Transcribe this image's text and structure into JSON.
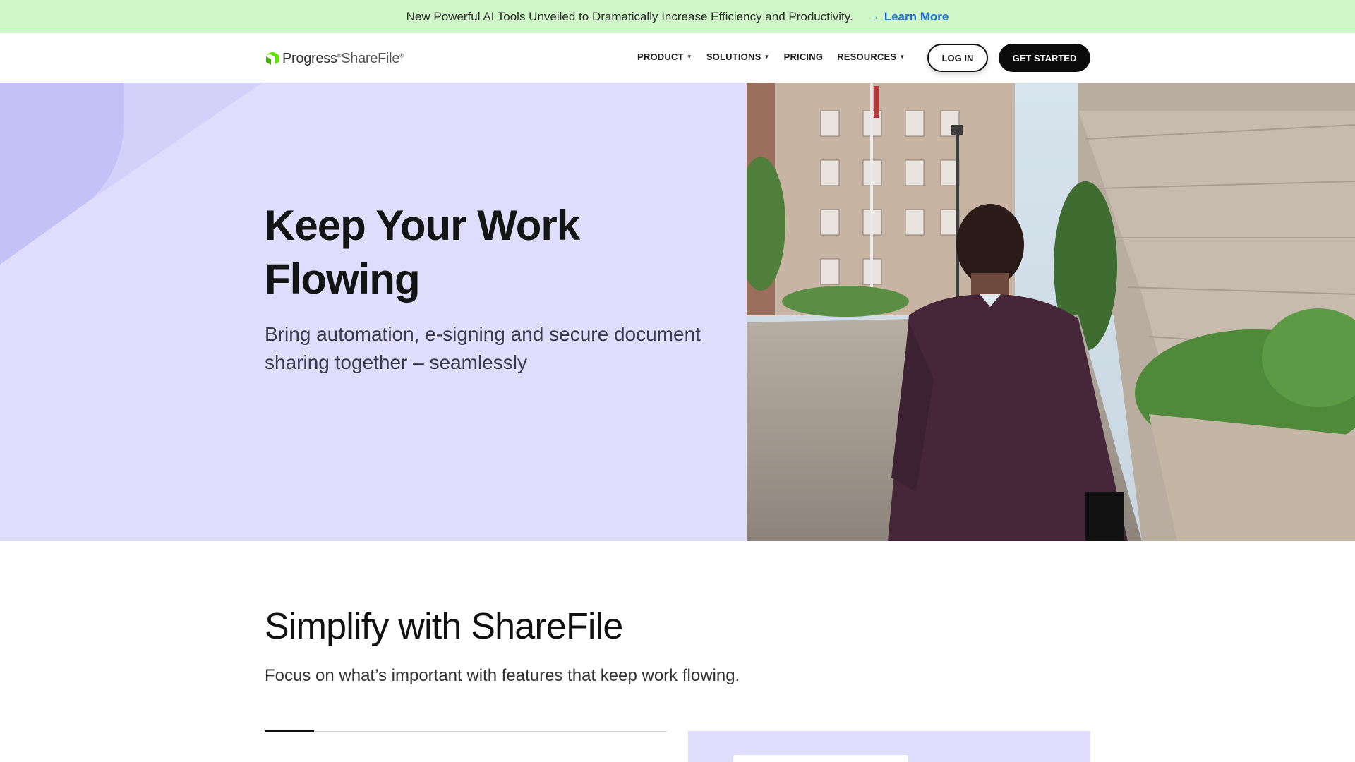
{
  "announcement": {
    "message": "New Powerful AI Tools Unveiled to Dramatically Increase Efficiency and Productivity.",
    "link_label": "Learn More",
    "link_icon": "arrow-right-icon"
  },
  "header": {
    "logo": {
      "brand": "Progress",
      "product": "ShareFile",
      "icon": "progress-logo-icon"
    },
    "nav": [
      {
        "label": "PRODUCT",
        "has_dropdown": true
      },
      {
        "label": "SOLUTIONS",
        "has_dropdown": true
      },
      {
        "label": "PRICING",
        "has_dropdown": false
      },
      {
        "label": "RESOURCES",
        "has_dropdown": true
      }
    ],
    "login_label": "LOG IN",
    "get_started_label": "GET STARTED"
  },
  "hero": {
    "title": "Keep Your Work Flowing",
    "subtitle": "Bring automation, e-signing and secure document sharing together – seamlessly",
    "image_alt": "Man in suit walking past office buildings"
  },
  "simplify": {
    "title": "Simplify with ShareFile",
    "subtitle": "Focus on what’s important with features that keep work flowing."
  },
  "colors": {
    "announcement_bg": "#cff7c7",
    "hero_bg": "#dfddfb",
    "link": "#1e6fd9",
    "brand_green": "#5ce500",
    "primary_button": "#0b0b0b"
  }
}
